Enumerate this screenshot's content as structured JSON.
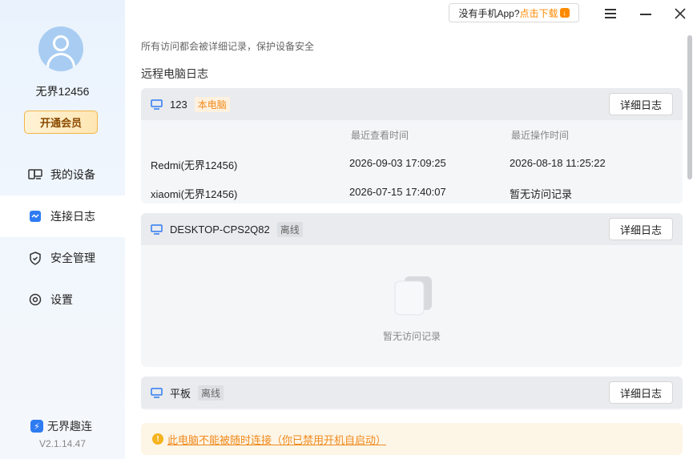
{
  "user": {
    "name": "无界12456",
    "vip_label": "开通会员"
  },
  "nav": {
    "items": [
      {
        "label": "我的设备",
        "icon": "devices-icon"
      },
      {
        "label": "连接日志",
        "icon": "log-icon",
        "active": true
      },
      {
        "label": "安全管理",
        "icon": "shield-icon"
      },
      {
        "label": "设置",
        "icon": "gear-icon"
      }
    ]
  },
  "brand": {
    "name": "无界趣连",
    "version": "V2.1.14.47"
  },
  "titlebar": {
    "download_prefix": "没有手机App?",
    "download_link": "点击下载"
  },
  "content": {
    "notice": "所有访问都会被详细记录，保护设备安全",
    "section_title": "远程电脑日志",
    "detail_button": "详细日志",
    "col_view": "最近查看时间",
    "col_op": "最近操作时间",
    "empty_text": "暂无访问记录",
    "devices": [
      {
        "name": "123",
        "tag": "本电脑",
        "rows": [
          {
            "name": "Redmi(无界12456)",
            "view": "2026-09-03 17:09:25",
            "op": "2026-08-18 11:25:22"
          },
          {
            "name": "xiaomi(无界12456)",
            "view": "2026-07-15 17:40:07",
            "op": "暂无访问记录"
          }
        ]
      },
      {
        "name": "DESKTOP-CPS2Q82",
        "tag": "离线"
      },
      {
        "name": "平板",
        "tag": "离线"
      }
    ]
  },
  "warning": {
    "text": "此电脑不能被随时连接（你已禁用开机自启动）"
  },
  "colors": {
    "accent": "#2f7bf2",
    "orange": "#f08a1c",
    "card_bg": "#f5f6f8",
    "card_head": "#e9ebee"
  }
}
